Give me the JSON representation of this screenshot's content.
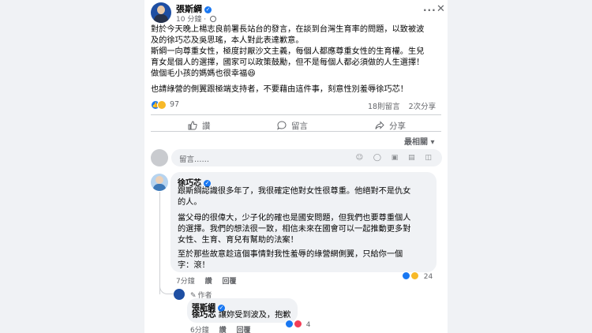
{
  "post": {
    "author": "張斯綱",
    "time": "10 分鐘",
    "more_label": "···",
    "close_label": "✕",
    "lines": [
      "對於今天晚上楊志良前署長站台的發言，在談到台灣生育率的問題，以致被波",
      "及的徐巧芯及吳思瑤，本人對此表達歉意。",
      "斯綱一向尊重女性，極度討厭沙文主義，每個人都應尊重女性的生育權。生兒",
      "育女是個人的選擇，國家可以政策鼓勵，但不是每個人都必須做的人生選擇！",
      "做個毛小孩的媽媽也很幸福😆",
      "也請綠營的側翼跟極端支持者，不要藉由這件事，刻意性別羞辱徐巧芯！"
    ],
    "reaction_count": "97",
    "comments_count": "18則留言",
    "shares_count": "2次分享"
  },
  "actions": {
    "like": "讚",
    "comment": "留言",
    "share": "分享"
  },
  "sort_label": "最相關 ▾",
  "comment_input": {
    "placeholder": "留言……"
  },
  "comments": [
    {
      "name": "徐巧芯",
      "paragraphs": [
        [
          "跟斯綱認識很多年了，我很確定他對女性很尊重。他絕對不是仇女",
          "的人。"
        ],
        [
          "當父母的很偉大，少子化的確也是國安問題，但我們也要尊重個人",
          "的選擇。我們的想法很一致，相信未來在國會可以一起推動更多對",
          "女性、生育、育兒有幫助的法案！"
        ],
        [
          "至於那些故意趁這個事情對我性羞辱的綠營網側翼，只給你一個",
          "字：滾！"
        ]
      ],
      "time": "7分鐘",
      "like": "讚",
      "reply": "回覆",
      "reaction_count": "24"
    },
    {
      "author_tag": "作者",
      "name": "張斯綱",
      "text_mention": "徐巧芯",
      "text_rest": " 讓妳受到波及，抱歉",
      "time": "6分鐘",
      "like": "讚",
      "reply": "回覆",
      "reaction_count": "4"
    }
  ],
  "colors": {
    "brand_blue": "#1877f2",
    "muted_text": "#65676b",
    "bubble_bg": "#f0f2f5"
  }
}
